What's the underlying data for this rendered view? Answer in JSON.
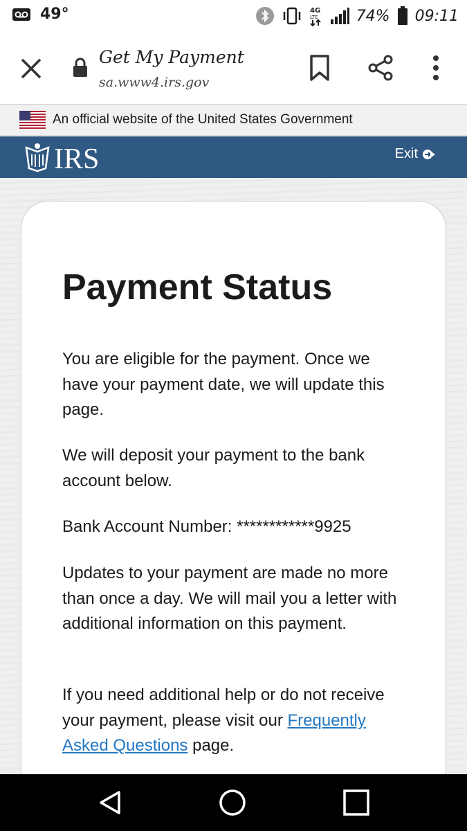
{
  "status_bar": {
    "temperature": "49°",
    "battery": "74%",
    "time": "09:11",
    "network": "4G LTE",
    "icons": [
      "voicemail-icon",
      "bluetooth-icon",
      "vibrate-icon",
      "network-4g-lte-icon",
      "signal-icon",
      "battery-icon"
    ]
  },
  "browser": {
    "page_title": "Get My Payment",
    "url": "sa.www4.irs.gov",
    "icons": [
      "close-icon",
      "lock-icon",
      "bookmark-icon",
      "share-icon",
      "more-vert-icon"
    ]
  },
  "gov_banner": {
    "text": "An official website of the United States Government",
    "icon": "us-flag-icon"
  },
  "irs_header": {
    "logo_text": "IRS",
    "exit_label": "Exit",
    "colors": {
      "header_bg": "#2f5882",
      "link": "#2378c3"
    }
  },
  "content": {
    "heading": "Payment Status",
    "paragraph1": "You are eligible for the payment. Once we have your payment date, we will update this page.",
    "paragraph2": "We will deposit your payment to the bank account below.",
    "bank_account": "Bank Account Number: ************9925",
    "paragraph4": "Updates to your payment are made no more than once a day. We will mail you a letter with additional information on this payment.",
    "paragraph5_before": "If you need additional help or do not receive your payment, please visit our ",
    "faq_link": "Frequently Asked Questions",
    "paragraph5_after": " page."
  },
  "nav_bar": {
    "icons": [
      "back-icon",
      "home-icon",
      "recents-icon"
    ]
  }
}
